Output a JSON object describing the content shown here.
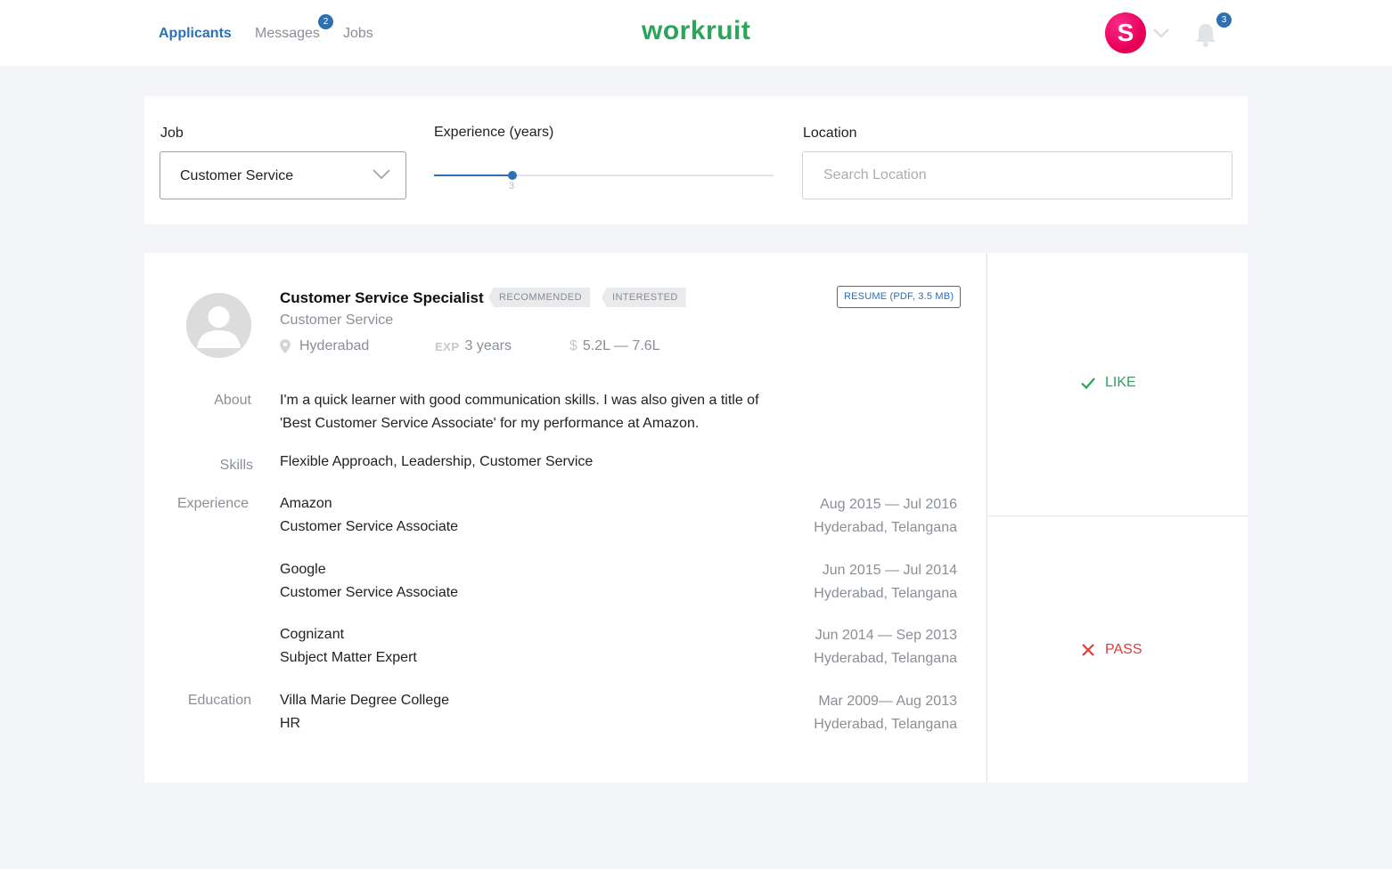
{
  "nav": {
    "items": [
      "Applicants",
      "Messages",
      "Jobs"
    ],
    "messages_badge": "2",
    "notifications_badge": "3"
  },
  "brand": {
    "logo": "workruit",
    "avatar_letter": "S"
  },
  "filters": {
    "job_label": "Job",
    "job_value": "Customer Service",
    "experience_label": "Experience (years)",
    "experience_value": 3,
    "experience_fraction": 0.23,
    "location_label": "Location",
    "location_placeholder": "Search Location"
  },
  "candidate": {
    "title": "Customer Service Specialist",
    "tags": [
      "RECOMMENDED",
      "INTERESTED"
    ],
    "resume": "RESUME (PDF, 3.5 MB)",
    "subtitle": "Customer Service",
    "location": "Hyderabad",
    "exp_tag": "EXP",
    "experience": "3 years",
    "salary_symbol": "$",
    "salary": "5.2L — 7.6L",
    "labels": {
      "about": "About",
      "skills": "Skills",
      "experience": "Experience",
      "education": "Education"
    },
    "about_line1": "I'm a quick learner with good communication skills. I was also given a title of",
    "about_line2": "'Best Customer Service Associate' for my performance at Amazon.",
    "skills": "Flexible Approach, Leadership, Customer Service",
    "experience_entries": [
      {
        "company": "Amazon",
        "role": "Customer Service Associate",
        "dates": "Aug 2015 — Jul 2016",
        "place": "Hyderabad, Telangana"
      },
      {
        "company": "Google",
        "role": "Customer Service Associate",
        "dates": "Jun 2015 — Jul 2014",
        "place": "Hyderabad, Telangana"
      },
      {
        "company": "Cognizant",
        "role": "Subject Matter Expert",
        "dates": "Jun 2014 — Sep 2013",
        "place": "Hyderabad, Telangana"
      }
    ],
    "education": {
      "school": "Villa Marie Degree College",
      "field": "HR",
      "dates": "Mar 2009— Aug 2013",
      "place": "Hyderabad, Telangana"
    }
  },
  "actions": {
    "like": "LIKE",
    "pass": "PASS"
  },
  "colors": {
    "accent": "#2d70b3",
    "brand": "#2aa55a",
    "like": "#2aa55a",
    "pass": "#e0393e",
    "avatar": "#e8005a"
  }
}
